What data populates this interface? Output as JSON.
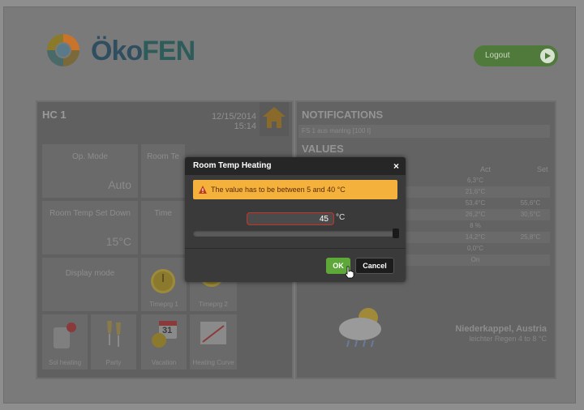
{
  "header": {
    "logo_text_a": "Öko",
    "logo_text_b": "FEN",
    "logout_label": "Logout"
  },
  "hc": {
    "title": "HC 1",
    "date": "12/15/2014",
    "time": "15:14"
  },
  "tiles": {
    "op_mode": {
      "label": "Op. Mode",
      "value": "Auto"
    },
    "room_temp": {
      "label": "Room Te"
    },
    "room_temp_set_down": {
      "label": "Room Temp Set Down",
      "value": "15°C"
    },
    "time_prog": {
      "label": "Time"
    },
    "display_mode": {
      "label": "Display mode"
    },
    "timeprog1": {
      "label": "Timeprg 1"
    },
    "timeprog2": {
      "label": "Timeprg 2"
    },
    "sol_heating": {
      "label": "Sol heating"
    },
    "party": {
      "label": "Party"
    },
    "vacation": {
      "label": "Vacation",
      "calendar_day": "31"
    },
    "heating_curve": {
      "label": "Heating Curve"
    }
  },
  "notifications": {
    "title": "NOTIFICATIONS",
    "items": [
      "FS 1 aus manlng [100 I]"
    ]
  },
  "values": {
    "title": "VALUES",
    "col_act": "Act",
    "col_set": "Set",
    "rows": [
      {
        "act": "6,3°C",
        "set": ""
      },
      {
        "act": "21,6°C",
        "set": ""
      },
      {
        "act": "53,4°C",
        "set": "55,6°C"
      },
      {
        "act": "26,2°C",
        "set": "30,5°C"
      },
      {
        "act": "8 %",
        "set": ""
      },
      {
        "act": "14,2°C",
        "set": "25,8°C"
      },
      {
        "act": "0,0°C",
        "set": ""
      },
      {
        "act": "On",
        "set": ""
      }
    ]
  },
  "weather": {
    "location": "Niederkappel, Austria",
    "forecast": "leichter Regen 4 to 8 °C"
  },
  "modal": {
    "title": "Room Temp Heating",
    "close_glyph": "×",
    "alert_text": "The value has to be between 5 and 40 °C",
    "value": "45",
    "unit": "°C",
    "ok_label": "OK",
    "cancel_label": "Cancel",
    "slider_fraction": 1.0
  },
  "colors": {
    "accent_green": "#5ea83a",
    "alert_yellow": "#f4b23c",
    "error_red": "#c8342a"
  }
}
